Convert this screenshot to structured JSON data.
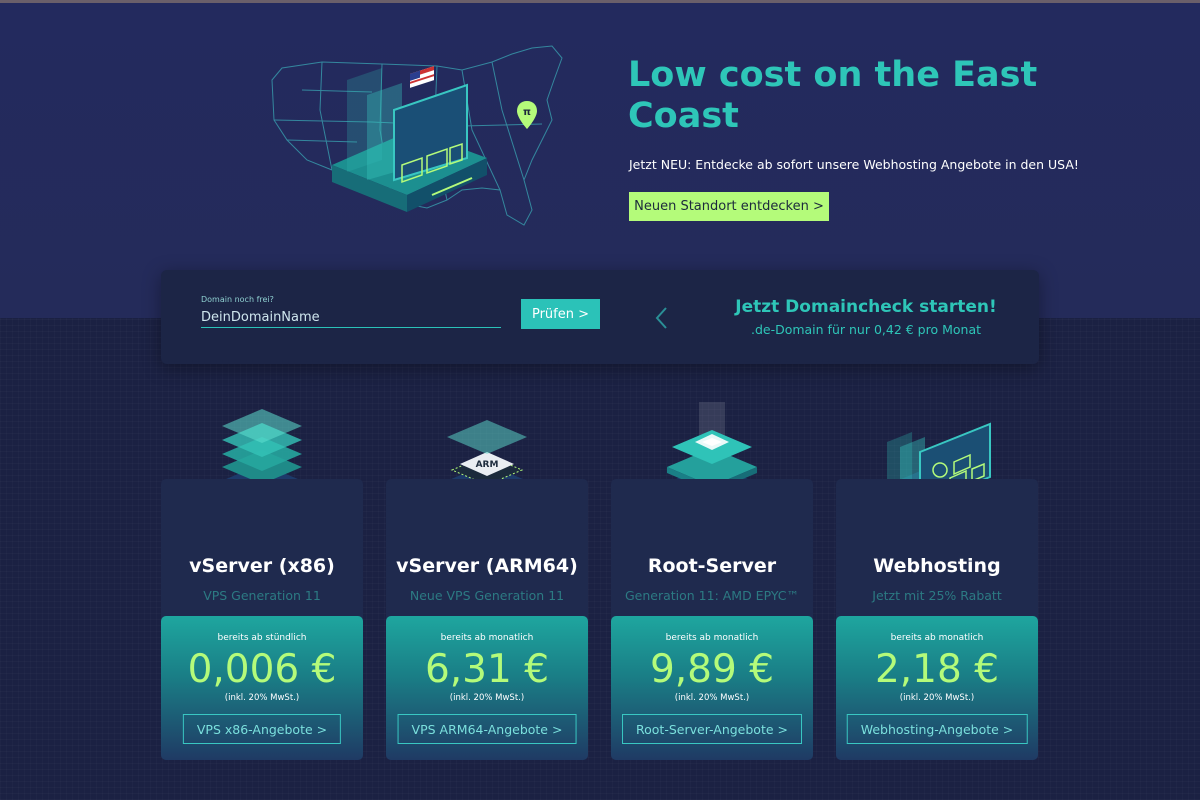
{
  "hero": {
    "title": "Low cost on the East Coast",
    "subtitle": "Jetzt NEU: Entdecke ab sofort unsere Webhosting Angebote in den USA!",
    "cta_label": "Neuen Standort entdecken >"
  },
  "domain": {
    "label": "Domain noch frei?",
    "placeholder": "DeinDomainName",
    "check_label": "Prüfen >",
    "promo_title": "Jetzt Domaincheck starten!",
    "promo_sub": ".de-Domain für nur 0,42 € pro Monat"
  },
  "cards": [
    {
      "title": "vServer (x86)",
      "subtitle": "VPS Generation 11",
      "price_prefix": "bereits ab stündlich",
      "price": "0,006 €",
      "tax": "(inkl. 20% MwSt.)",
      "button": "VPS x86-Angebote >"
    },
    {
      "title": "vServer (ARM64)",
      "subtitle": "Neue VPS Generation 11",
      "price_prefix": "bereits ab monatlich",
      "price": "6,31 €",
      "tax": "(inkl. 20% MwSt.)",
      "button": "VPS ARM64-Angebote >",
      "chip_label": "ARM"
    },
    {
      "title": "Root-Server",
      "subtitle": "Generation 11: AMD EPYC™",
      "price_prefix": "bereits ab monatlich",
      "price": "9,89 €",
      "tax": "(inkl. 20% MwSt.)",
      "button": "Root-Server-Angebote >"
    },
    {
      "title": "Webhosting",
      "subtitle": "Jetzt mit 25% Rabatt",
      "price_prefix": "bereits ab monatlich",
      "price": "2,18 €",
      "tax": "(inkl. 20% MwSt.)",
      "button": "Webhosting-Angebote >"
    }
  ],
  "colors": {
    "accent": "#2ec6b8",
    "lime": "#b4fb7a",
    "hero_bg": "#232a5e",
    "page_bg": "#1b2143"
  },
  "icons": [
    "usa-map-server-illustration",
    "location-pin-icon",
    "chevron-left-icon",
    "layers-server-illustration",
    "arm-chip-server-illustration",
    "root-server-illustration",
    "webhosting-server-illustration"
  ]
}
